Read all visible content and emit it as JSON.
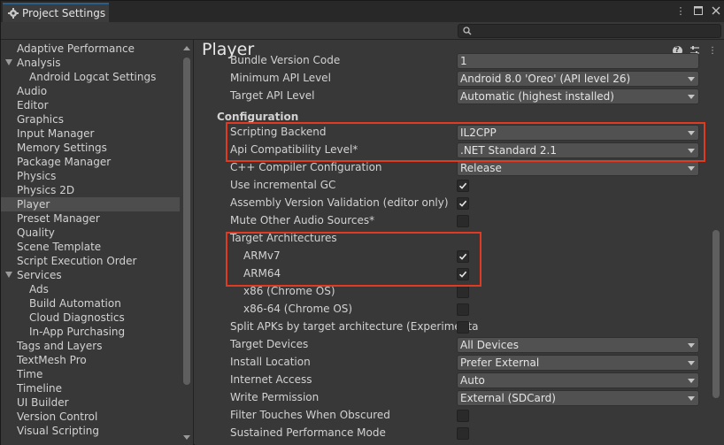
{
  "window": {
    "tab_title": "Project Settings",
    "icons": [
      "gear-icon",
      "kebab-menu-icon",
      "maximize-icon",
      "close-icon"
    ]
  },
  "search": {
    "placeholder": "",
    "icon": "search-icon"
  },
  "sidebar": {
    "items": [
      {
        "label": "Adaptive Performance",
        "indent": 0
      },
      {
        "label": "Analysis",
        "indent": 0,
        "expanded": true
      },
      {
        "label": "Android Logcat Settings",
        "indent": 1
      },
      {
        "label": "Audio",
        "indent": 0
      },
      {
        "label": "Editor",
        "indent": 0
      },
      {
        "label": "Graphics",
        "indent": 0
      },
      {
        "label": "Input Manager",
        "indent": 0
      },
      {
        "label": "Memory Settings",
        "indent": 0
      },
      {
        "label": "Package Manager",
        "indent": 0
      },
      {
        "label": "Physics",
        "indent": 0
      },
      {
        "label": "Physics 2D",
        "indent": 0
      },
      {
        "label": "Player",
        "indent": 0,
        "selected": true
      },
      {
        "label": "Preset Manager",
        "indent": 0
      },
      {
        "label": "Quality",
        "indent": 0
      },
      {
        "label": "Scene Template",
        "indent": 0
      },
      {
        "label": "Script Execution Order",
        "indent": 0
      },
      {
        "label": "Services",
        "indent": 0,
        "expanded": true
      },
      {
        "label": "Ads",
        "indent": 1
      },
      {
        "label": "Build Automation",
        "indent": 1
      },
      {
        "label": "Cloud Diagnostics",
        "indent": 1
      },
      {
        "label": "In-App Purchasing",
        "indent": 1
      },
      {
        "label": "Tags and Layers",
        "indent": 0
      },
      {
        "label": "TextMesh Pro",
        "indent": 0
      },
      {
        "label": "Time",
        "indent": 0
      },
      {
        "label": "Timeline",
        "indent": 0
      },
      {
        "label": "UI Builder",
        "indent": 0
      },
      {
        "label": "Version Control",
        "indent": 0
      },
      {
        "label": "Visual Scripting",
        "indent": 0
      }
    ]
  },
  "panel": {
    "title": "Player",
    "icons": [
      "help-icon",
      "settings-sliders-icon",
      "kebab-menu-icon"
    ],
    "partial_row": {
      "label": "Bundle Version Code",
      "value": "1"
    },
    "rows_top": [
      {
        "label": "Minimum API Level",
        "type": "dropdown",
        "value": "Android 8.0 'Oreo' (API level 26)"
      },
      {
        "label": "Target API Level",
        "type": "dropdown",
        "value": "Automatic (highest installed)"
      }
    ],
    "configuration_header": "Configuration",
    "rows_config": [
      {
        "label": "Scripting Backend",
        "type": "dropdown",
        "value": "IL2CPP"
      },
      {
        "label": "Api Compatibility Level*",
        "type": "dropdown",
        "value": ".NET Standard 2.1"
      },
      {
        "label": "C++ Compiler Configuration",
        "type": "dropdown",
        "value": "Release"
      },
      {
        "label": "Use incremental GC",
        "type": "checkbox",
        "checked": true
      },
      {
        "label": "Assembly Version Validation (editor only)",
        "type": "checkbox",
        "checked": true
      },
      {
        "label": "Mute Other Audio Sources*",
        "type": "checkbox",
        "checked": false
      },
      {
        "label": "Target Architectures",
        "type": "header"
      },
      {
        "label": "ARMv7",
        "type": "checkbox",
        "checked": true,
        "sub": true
      },
      {
        "label": "ARM64",
        "type": "checkbox",
        "checked": true,
        "sub": true
      },
      {
        "label": "x86 (Chrome OS)",
        "type": "checkbox",
        "checked": false,
        "sub": true
      },
      {
        "label": "x86-64 (Chrome OS)",
        "type": "checkbox",
        "checked": false,
        "sub": true
      },
      {
        "label": "Split APKs by target architecture (Experimenta",
        "type": "checkbox",
        "checked": false
      },
      {
        "label": "Target Devices",
        "type": "dropdown",
        "value": "All Devices"
      },
      {
        "label": "Install Location",
        "type": "dropdown",
        "value": "Prefer External"
      },
      {
        "label": "Internet Access",
        "type": "dropdown",
        "value": "Auto"
      },
      {
        "label": "Write Permission",
        "type": "dropdown",
        "value": "External (SDCard)"
      },
      {
        "label": "Filter Touches When Obscured",
        "type": "checkbox",
        "checked": false
      },
      {
        "label": "Sustained Performance Mode",
        "type": "checkbox",
        "checked": false
      }
    ]
  },
  "colors": {
    "highlight": "#e03a22",
    "selected_item": "#4d4d4d",
    "tab_accent": "#2c5d87"
  }
}
